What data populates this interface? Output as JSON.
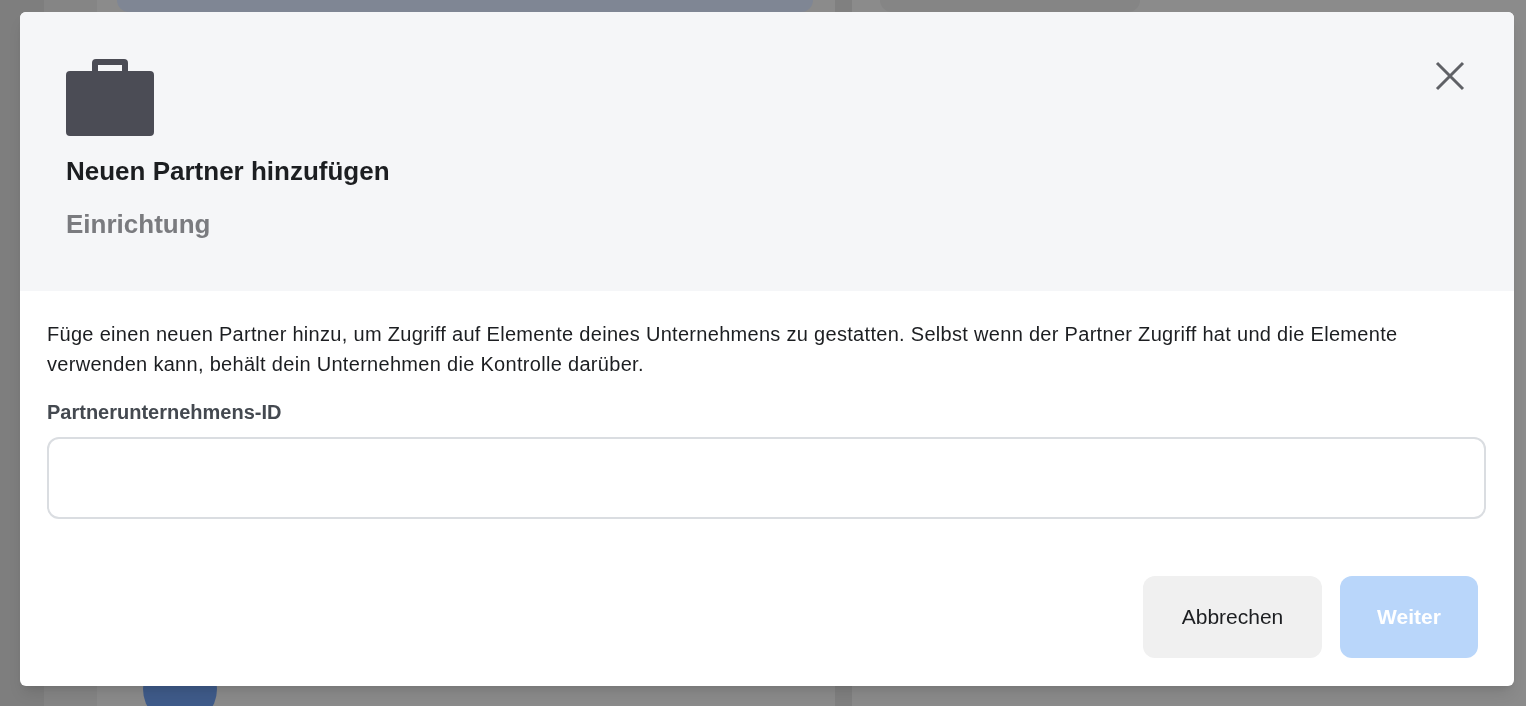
{
  "dialog": {
    "title": "Neuen Partner hinzufügen",
    "subtitle": "Einrichtung",
    "description": "Füge einen neuen Partner hinzu, um Zugriff auf Elemente deines Unternehmens zu gestatten. Selbst wenn der Partner Zugriff hat und die Elemente verwenden kann, behält dein Unternehmen die Kontrolle darüber.",
    "field": {
      "label": "Partnerunternehmens-ID"
    },
    "buttons": [
      {
        "label": "Abbrechen",
        "kind": "secondary",
        "disabled": false
      },
      {
        "label": "Weiter",
        "kind": "primary",
        "disabled": true
      }
    ]
  }
}
